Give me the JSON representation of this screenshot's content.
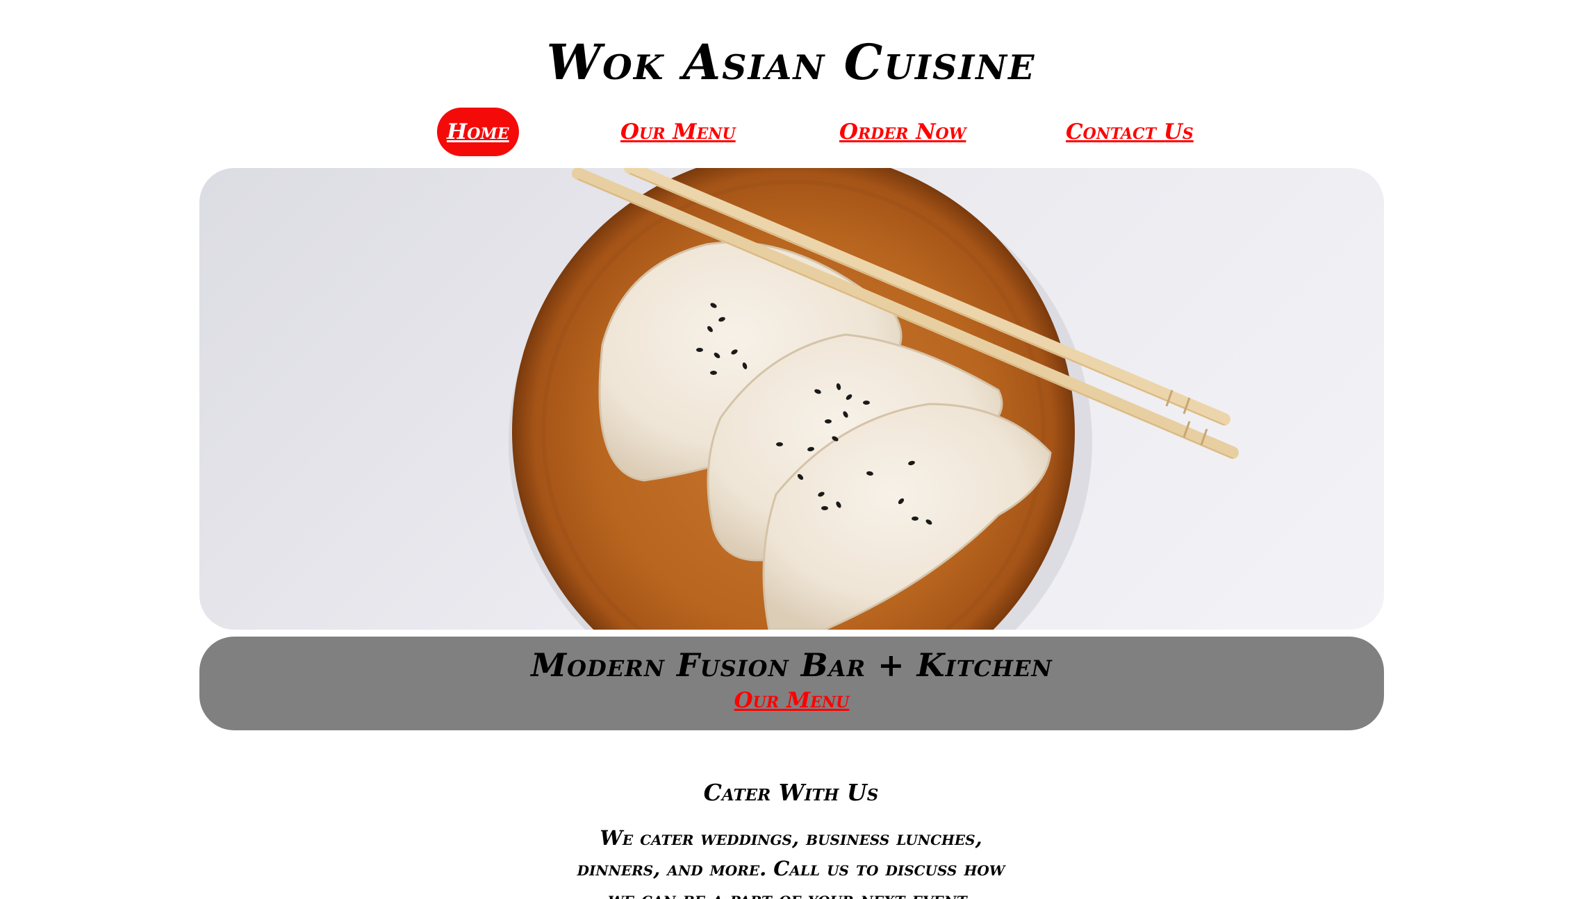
{
  "header": {
    "title": "Wok Asian Cuisine"
  },
  "nav": {
    "items": [
      {
        "label": "Home",
        "active": true
      },
      {
        "label": "Our Menu",
        "active": false
      },
      {
        "label": "Order Now",
        "active": false
      },
      {
        "label": "Contact Us",
        "active": false
      }
    ]
  },
  "hero": {
    "image_alt": "Dumplings with sesame seeds on a wooden plate with chopsticks"
  },
  "banner": {
    "title": "Modern Fusion Bar + Kitchen",
    "link_label": "Our Menu"
  },
  "cater": {
    "heading": "Cater With Us",
    "text": "We cater weddings, business lunches, dinners, and more. Call us to discuss how we can be a part of your next event."
  },
  "colors": {
    "accent": "#ff0000",
    "banner_bg": "#808080",
    "active_nav_bg": "#f50a0a"
  }
}
